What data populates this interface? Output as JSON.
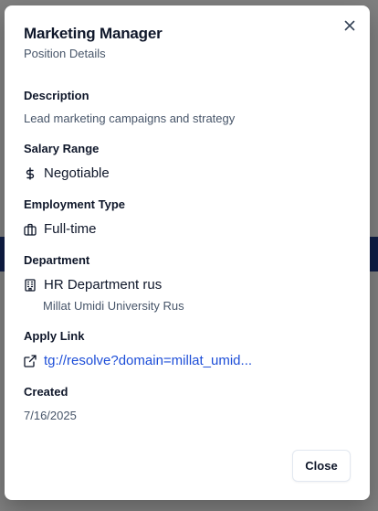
{
  "dialog": {
    "title": "Marketing Manager",
    "subtitle": "Position Details",
    "close_icon": "close-icon",
    "close_button_label": "Close"
  },
  "description": {
    "label": "Description",
    "value": "Lead marketing campaigns and strategy"
  },
  "salary": {
    "label": "Salary Range",
    "icon": "dollar-icon",
    "value": "Negotiable"
  },
  "employment": {
    "label": "Employment Type",
    "icon": "briefcase-icon",
    "value": "Full-time"
  },
  "department": {
    "label": "Department",
    "icon": "building-icon",
    "name": "HR Department rus",
    "university": "Millat Umidi University Rus"
  },
  "apply": {
    "label": "Apply Link",
    "icon": "external-link-icon",
    "link_text": "tg://resolve?domain=millat_umid..."
  },
  "created": {
    "label": "Created",
    "value": "7/16/2025"
  },
  "colors": {
    "link": "#1d4ed8",
    "muted_text": "#475569",
    "text": "#0f172a",
    "overlay": "rgba(0,0,0,0.5)"
  }
}
